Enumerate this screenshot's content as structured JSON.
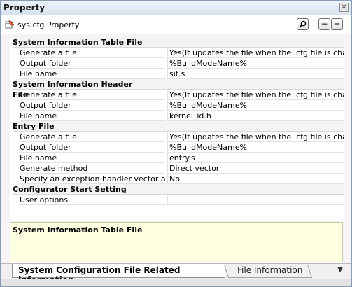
{
  "window": {
    "title": "Property"
  },
  "toolbar": {
    "label": "sys.cfg Property",
    "search_icon": "search-icon",
    "collapse_label": "−",
    "expand_label": "+"
  },
  "categories": [
    {
      "name": "System Information Table File",
      "props": [
        {
          "name": "Generate a file",
          "value": "Yes(It updates the file when the .cfg file is change"
        },
        {
          "name": "Output folder",
          "value": "%BuildModeName%"
        },
        {
          "name": "File name",
          "value": "sit.s"
        }
      ]
    },
    {
      "name": "System Information Header File",
      "props": [
        {
          "name": "Generate a file",
          "value": "Yes(It updates the file when the .cfg file is change"
        },
        {
          "name": "Output folder",
          "value": "%BuildModeName%"
        },
        {
          "name": "File name",
          "value": "kernel_id.h"
        }
      ]
    },
    {
      "name": "Entry File",
      "props": [
        {
          "name": "Generate a file",
          "value": "Yes(It updates the file when the .cfg file is change"
        },
        {
          "name": "Output folder",
          "value": "%BuildModeName%"
        },
        {
          "name": "File name",
          "value": "entry.s"
        },
        {
          "name": "Generate method",
          "value": "Direct vector"
        },
        {
          "name": "Specify an exception handler vector ad",
          "value": "No"
        }
      ]
    },
    {
      "name": "Configurator Start Setting",
      "props": [
        {
          "name": "User options",
          "value": ""
        }
      ]
    }
  ],
  "description": {
    "text": "System Information Table File"
  },
  "tabs": {
    "active": "System Configuration File Related Information",
    "inactive": "File Information",
    "menu_glyph": "▼"
  },
  "colors": {
    "description_bg": "#ffffe1",
    "category_bg": "#f3f3f3"
  }
}
